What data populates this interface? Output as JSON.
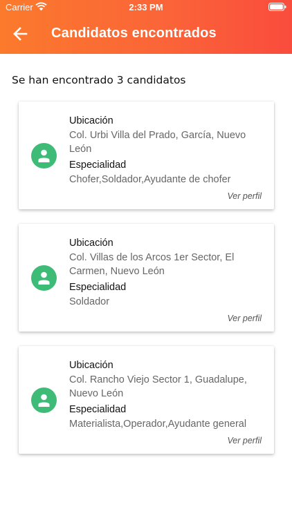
{
  "status_bar": {
    "carrier": "Carrier",
    "time": "2:33 PM"
  },
  "header": {
    "title": "Candidatos encontrados"
  },
  "summary": "Se han encontrado 3 candidatos",
  "labels": {
    "location": "Ubicación",
    "specialty": "Especialidad",
    "view_profile": "Ver perfil"
  },
  "candidates": [
    {
      "location": "Col. Urbi Villa del Prado, García, Nuevo León",
      "specialty": "Chofer,Soldador,Ayudante de chofer"
    },
    {
      "location": "Col. Villas de los Arcos 1er Sector, El Carmen, Nuevo León",
      "specialty": "Soldador"
    },
    {
      "location": "Col. Rancho Viejo Sector 1, Guadalupe, Nuevo León",
      "specialty": "Materialista,Operador,Ayudante general"
    }
  ],
  "colors": {
    "header_start": "#fb7a2c",
    "header_end": "#f94c3d",
    "avatar": "#3fbb78"
  }
}
